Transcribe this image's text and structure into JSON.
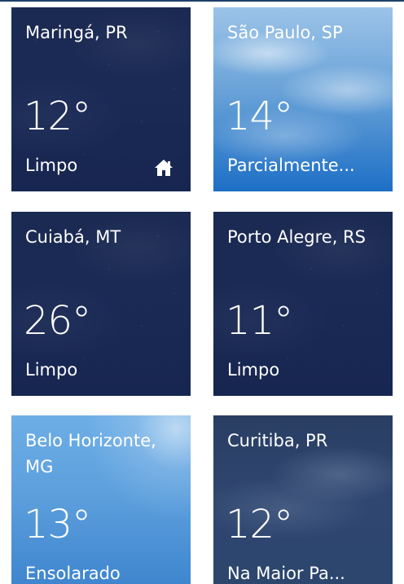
{
  "tiles": [
    {
      "city": "Maringá, PR",
      "temp": "12°",
      "condition": "Limpo",
      "icon": "home-icon"
    },
    {
      "city": "São Paulo, SP",
      "temp": "14°",
      "condition": "Parcialmente..."
    },
    {
      "city": "Cuiabá, MT",
      "temp": "26°",
      "condition": "Limpo"
    },
    {
      "city": "Porto Alegre, RS",
      "temp": "11°",
      "condition": "Limpo"
    },
    {
      "city": "Belo Horizonte, MG",
      "temp": "13°",
      "condition": "Ensolarado"
    },
    {
      "city": "Curitiba, PR",
      "temp": "12°",
      "condition": "Na Maior Pa..."
    }
  ],
  "colors": {
    "night": "#1a2a55",
    "partly": "#1d6fc6",
    "sunny": "#4f95d8",
    "cloudy": "#2d446b",
    "text": "#ffffff"
  }
}
